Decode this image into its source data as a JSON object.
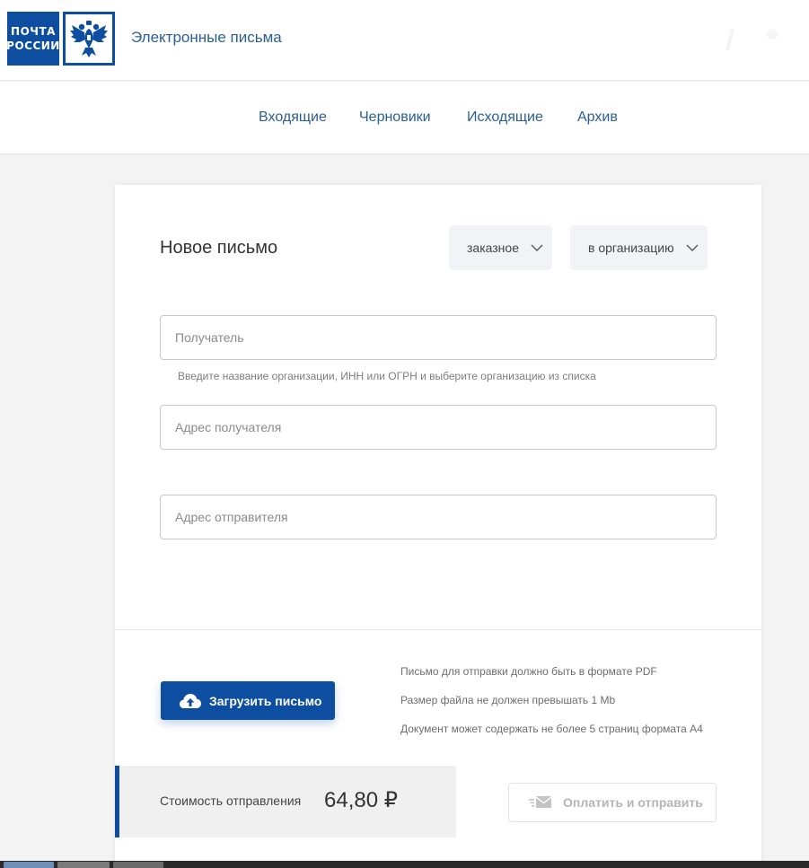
{
  "header": {
    "logo_line1": "ПОЧТА",
    "logo_line2": "РОССИИ",
    "logo_emblem_icon": "double-headed-eagle-icon",
    "app_title": "Электронные письма",
    "brand_color": "#0d4ea1"
  },
  "nav": {
    "items": [
      {
        "label": "Входящие"
      },
      {
        "label": "Черновики"
      },
      {
        "label": "Исходящие"
      },
      {
        "label": "Архив"
      }
    ]
  },
  "form": {
    "title": "Новое письмо",
    "letter_type": {
      "selected": "заказное",
      "icon": "chevron-down-icon"
    },
    "recipient_type": {
      "selected": "в организацию",
      "icon": "chevron-down-icon"
    },
    "recipient": {
      "value": "",
      "placeholder": "Получатель"
    },
    "recipient_hint": "Введите название организации, ИНН или ОГРН и выберите организацию из списка",
    "recipient_address": {
      "value": "",
      "placeholder": "Адрес получателя"
    },
    "sender_address": {
      "value": "",
      "placeholder": "Адрес отправителя"
    }
  },
  "upload": {
    "button_label": "Загрузить письмо",
    "icon": "cloud-upload-icon",
    "requirements": [
      "Письмо для отправки должно быть в формате PDF",
      "Размер файла не должен превышать 1 Mb",
      "Документ может содержать не более 5 страниц формата А4"
    ]
  },
  "payment": {
    "cost_label": "Стоимость отправления",
    "cost_value": "64,80 ₽",
    "pay_button_label": "Оплатить и отправить",
    "pay_icon": "envelope-send-icon",
    "pay_button_state": "disabled"
  }
}
